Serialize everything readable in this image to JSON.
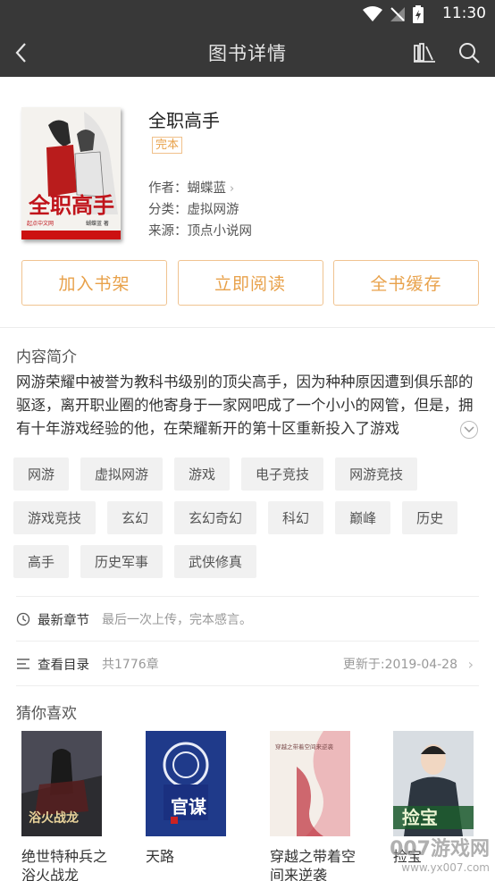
{
  "status_bar": {
    "time": "11:30"
  },
  "app_bar": {
    "title": "图书详情"
  },
  "book": {
    "title": "全职高手",
    "badge": "完本",
    "author_label": "作者：",
    "author": "蝴蝶蓝",
    "category_label": "分类：",
    "category": "虚拟网游",
    "source_label": "来源：",
    "source": "顶点小说网",
    "cover_text": "全职高手",
    "cover_author": "蝴蝶蓝 著",
    "cover_publisher": "起点中文网"
  },
  "actions": [
    {
      "label": "加入书架"
    },
    {
      "label": "立即阅读"
    },
    {
      "label": "全书缓存"
    }
  ],
  "intro": {
    "heading": "内容简介",
    "text": "网游荣耀中被誉为教科书级别的顶尖高手，因为种种原因遭到俱乐部的驱逐，离开职业圈的他寄身于一家网吧成了一个小小的网管，但是，拥有十年游戏经验的他，在荣耀新开的第十区重新投入了游戏"
  },
  "tags": [
    "网游",
    "虚拟网游",
    "游戏",
    "电子竞技",
    "网游竞技",
    "游戏竞技",
    "玄幻",
    "玄幻奇幻",
    "科幻",
    "巅峰",
    "历史",
    "高手",
    "历史军事",
    "武侠修真"
  ],
  "latest": {
    "label": "最新章节",
    "text": "最后一次上传，完本感言。"
  },
  "catalog": {
    "label": "查看目录",
    "count": "共1776章",
    "updated": "更新于:2019-04-28"
  },
  "recommend": {
    "heading": "猜你喜欢",
    "books": [
      {
        "name": "绝世特种兵之浴火战龙",
        "cover_text": "浴火战龙"
      },
      {
        "name": "天路",
        "cover_text": "官谋"
      },
      {
        "name": "穿越之带着空间来逆袭",
        "cover_text": "穿越之带着空间来逆袭"
      },
      {
        "name": "捡宝",
        "cover_text": "捡宝"
      }
    ]
  },
  "watermark": {
    "text": "007游戏网",
    "url": "www.yx007.com"
  },
  "colors": {
    "accent": "#e8a14a",
    "bar": "#383838",
    "tag_bg": "#f1f1f1"
  }
}
